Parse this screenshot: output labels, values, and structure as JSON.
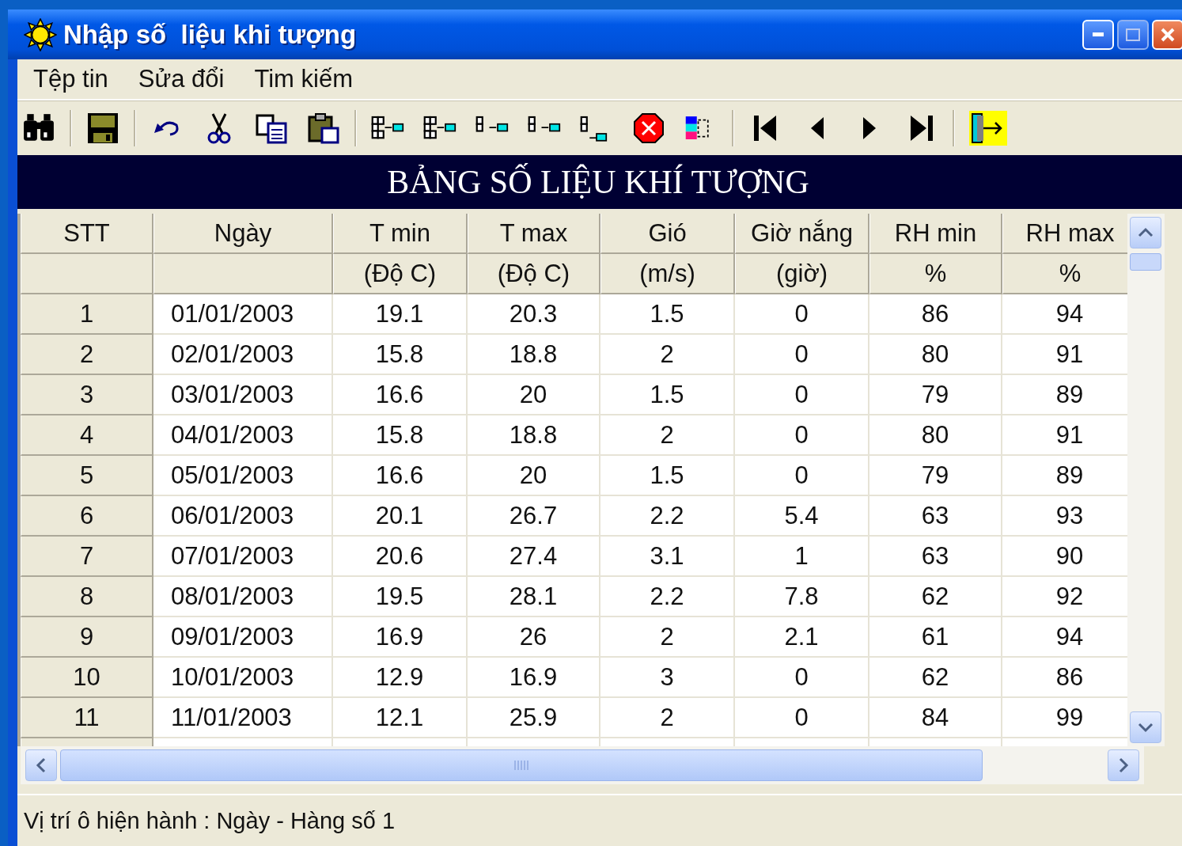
{
  "window": {
    "title": "Nhập số  liệu khi tượng"
  },
  "menu": [
    "Tệp tin",
    "Sửa đổi",
    "Tim kiếm"
  ],
  "banner": "BẢNG SỐ LIỆU KHÍ TƯỢNG",
  "table": {
    "columns": [
      {
        "label": "STT"
      },
      {
        "label": "Ngày"
      },
      {
        "label": "T min",
        "unit": "(Độ C)"
      },
      {
        "label": "T max",
        "unit": "(Độ C)"
      },
      {
        "label": "Gió",
        "unit": "(m/s)"
      },
      {
        "label": "Giờ nắng",
        "unit": "(giờ)"
      },
      {
        "label": "RH min",
        "unit": "%"
      },
      {
        "label": "RH max",
        "unit": "%"
      }
    ],
    "rows": [
      [
        "1",
        "01/01/2003",
        "19.1",
        "20.3",
        "1.5",
        "0",
        "86",
        "94"
      ],
      [
        "2",
        "02/01/2003",
        "15.8",
        "18.8",
        "2",
        "0",
        "80",
        "91"
      ],
      [
        "3",
        "03/01/2003",
        "16.6",
        "20",
        "1.5",
        "0",
        "79",
        "89"
      ],
      [
        "4",
        "04/01/2003",
        "15.8",
        "18.8",
        "2",
        "0",
        "80",
        "91"
      ],
      [
        "5",
        "05/01/2003",
        "16.6",
        "20",
        "1.5",
        "0",
        "79",
        "89"
      ],
      [
        "6",
        "06/01/2003",
        "20.1",
        "26.7",
        "2.2",
        "5.4",
        "63",
        "93"
      ],
      [
        "7",
        "07/01/2003",
        "20.6",
        "27.4",
        "3.1",
        "1",
        "63",
        "90"
      ],
      [
        "8",
        "08/01/2003",
        "19.5",
        "28.1",
        "2.2",
        "7.8",
        "62",
        "92"
      ],
      [
        "9",
        "09/01/2003",
        "16.9",
        "26",
        "2",
        "2.1",
        "61",
        "94"
      ],
      [
        "10",
        "10/01/2003",
        "12.9",
        "16.9",
        "3",
        "0",
        "62",
        "86"
      ],
      [
        "11",
        "11/01/2003",
        "12.1",
        "25.9",
        "2",
        "0",
        "84",
        "99"
      ]
    ]
  },
  "status_bar": "Vị trí ô hiện hành : Ngày - Hàng số 1"
}
